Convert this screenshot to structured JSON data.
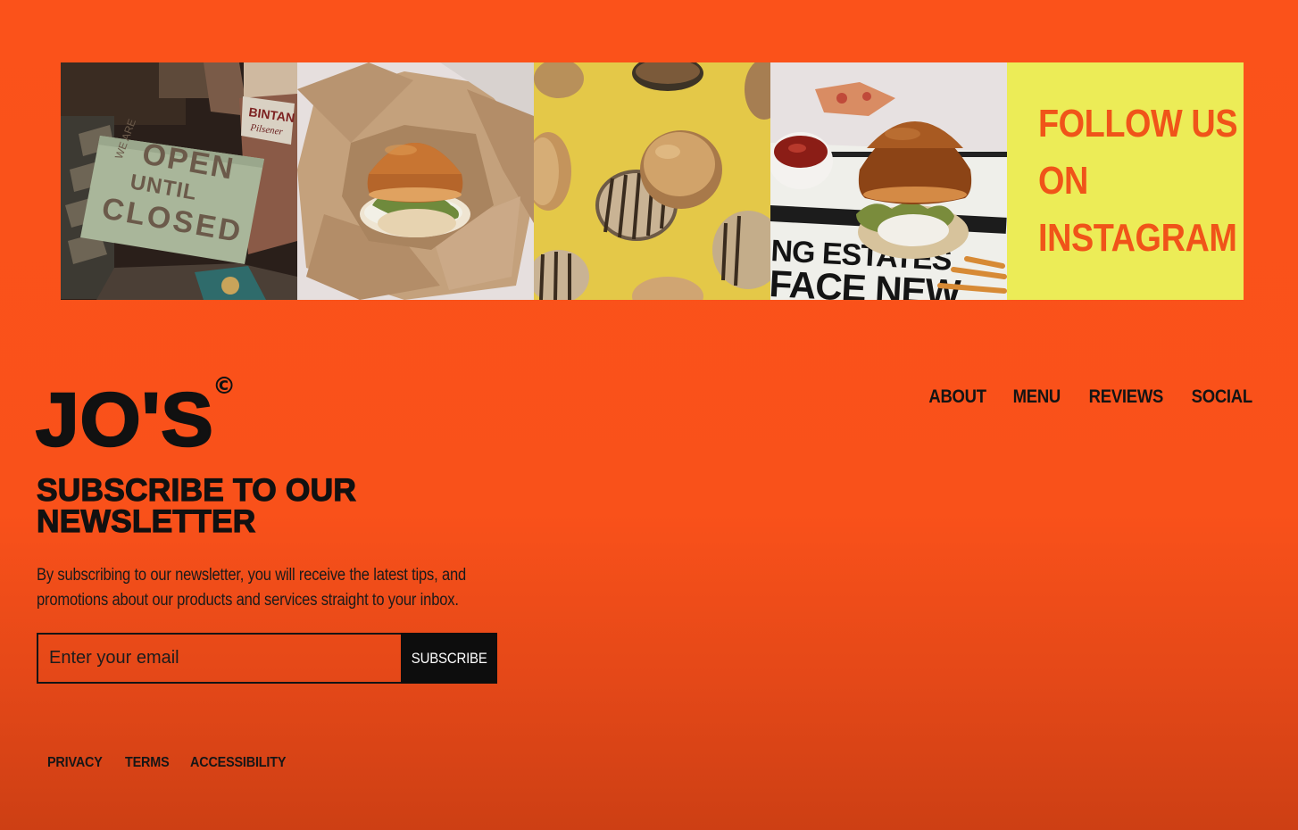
{
  "theme": {
    "background": "#fb521a",
    "text": "#111111",
    "follow_tile_bg": "#ecec57",
    "follow_tile_text": "#f05419",
    "button_bg": "#0d0d0d",
    "button_text": "#ffffff"
  },
  "instagram": {
    "photos": [
      {
        "icon": "open-until-closed-sign-photo",
        "sign_lines": [
          "WE ARE",
          "OPEN",
          "UNTIL",
          "CLOSED"
        ],
        "label_lines": [
          "BINTAN",
          "Pilsener"
        ]
      },
      {
        "icon": "burger-in-paper-wrap-photo"
      },
      {
        "icon": "grilled-buns-on-yellow-photo"
      },
      {
        "icon": "burger-on-newspaper-photo",
        "newspaper_lines": [
          "NG ESTATES",
          "FACE NEW"
        ]
      }
    ],
    "follow_lines": [
      "FOLLOW US",
      "ON",
      "INSTAGRAM"
    ]
  },
  "brand": {
    "name": "JO'S",
    "mark": "©"
  },
  "nav": {
    "items": [
      "ABOUT",
      "MENU",
      "REVIEWS",
      "SOCIAL"
    ]
  },
  "newsletter": {
    "heading": "SUBSCRIBE TO OUR NEWSLETTER",
    "description": "By subscribing to our newsletter, you will receive the latest tips, and promotions about our products and services straight to your inbox.",
    "email_placeholder": "Enter your email",
    "email_value": "",
    "button_label": "SUBSCRIBE"
  },
  "legal": {
    "items": [
      "PRIVACY",
      "TERMS",
      "ACCESSIBILITY"
    ]
  }
}
